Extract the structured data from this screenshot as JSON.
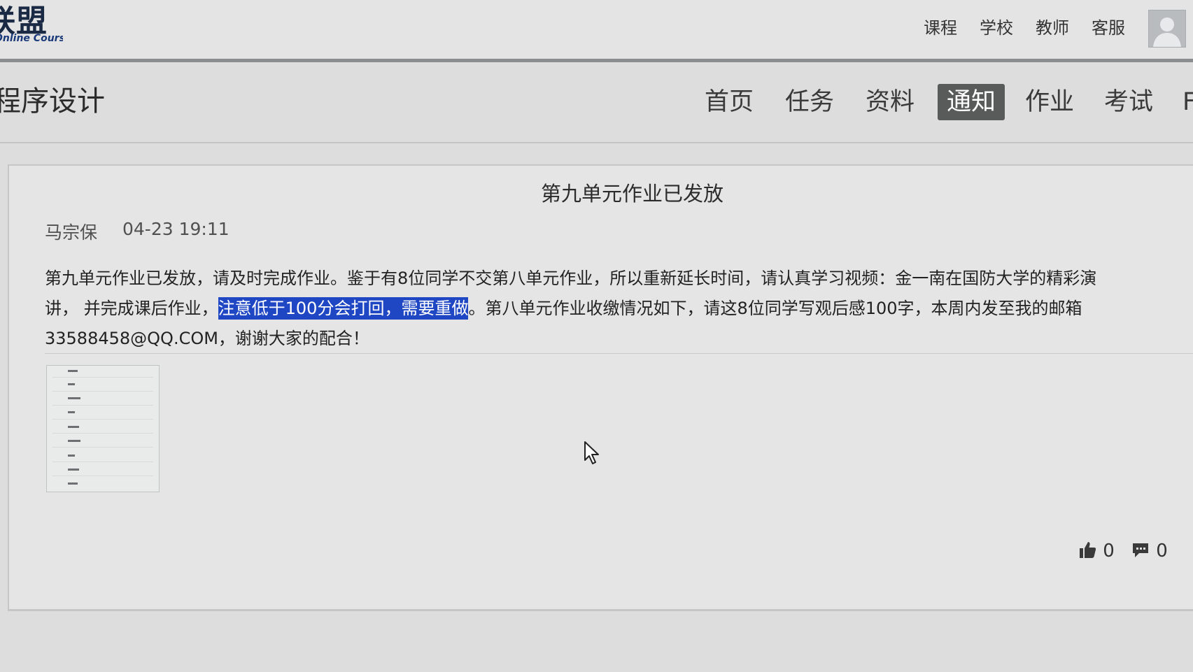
{
  "logo": {
    "main": "联盟",
    "sub": "Online Courses"
  },
  "top_nav": [
    "课程",
    "学校",
    "教师",
    "客服"
  ],
  "course": {
    "title": "程序设计"
  },
  "tabs": [
    {
      "label": "首页",
      "active": false
    },
    {
      "label": "任务",
      "active": false
    },
    {
      "label": "资料",
      "active": false
    },
    {
      "label": "通知",
      "active": true
    },
    {
      "label": "作业",
      "active": false
    },
    {
      "label": "考试",
      "active": false
    },
    {
      "label": "F",
      "active": false
    }
  ],
  "notice": {
    "title": "第九单元作业已发放",
    "author": "马宗保",
    "time": "04-23 19:11",
    "line1": "第九单元作业已发放，请及时完成作业。鉴于有8位同学不交第八单元作业，所以重新延长时间，请认真学习视频：金一南在国防大学的精彩演",
    "line2_a": "讲，  并完成课后作业，",
    "line2_highlight": "注意低于100分会打回，需要重做",
    "line2_b": "。第八单元作业收缴情况如下，请这8位同学写观后感100字，本周内发至我的邮箱",
    "line3": "33588458@QQ.COM，谢谢大家的配合！",
    "likes": "0",
    "comments": "0"
  },
  "colors": {
    "active_tab_bg": "#595a5a",
    "selection_highlight": "#1f47c4"
  },
  "icons": [
    "thumbs-up-icon",
    "comment-icon",
    "mouse-cursor-icon",
    "user-avatar-icon"
  ]
}
